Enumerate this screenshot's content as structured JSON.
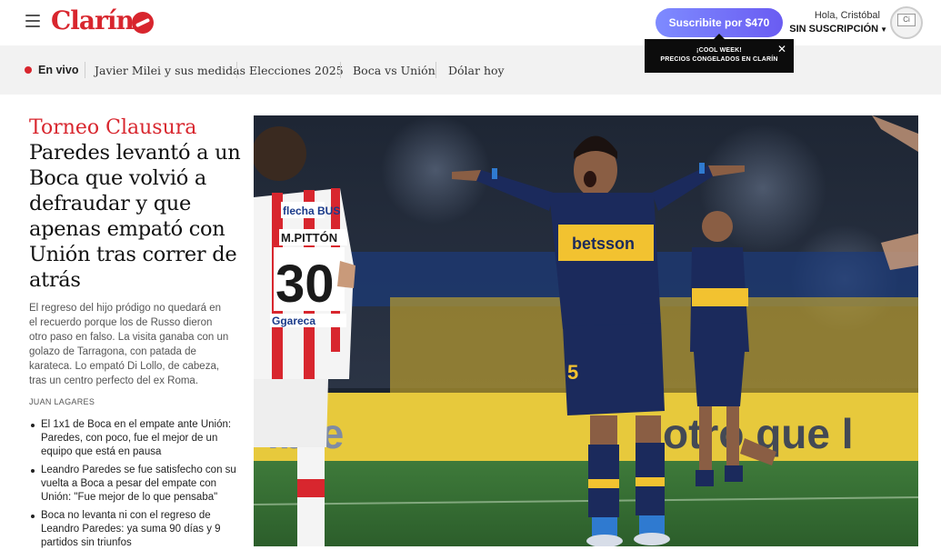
{
  "header": {
    "logo_text": "Clarín",
    "subscribe_label": "Suscribite por $470",
    "greeting": "Hola, Cristóbal",
    "subscription_status": "SIN SUSCRIPCIÓN",
    "avatar_alt": "Ci"
  },
  "promo": {
    "line1": "¡COOL WEEK!",
    "line2": "PRECIOS CONGELADOS EN CLARÍN",
    "close": "✕"
  },
  "nav": {
    "live_label": "En vivo",
    "items": [
      {
        "label": "Javier Milei y sus medidas"
      },
      {
        "label": "Elecciones 2025"
      },
      {
        "label": "Boca vs Unión"
      },
      {
        "label": "Dólar hoy"
      }
    ]
  },
  "article": {
    "section": "Torneo Clausura",
    "headline": "Paredes levantó a un Boca que volvió a defraudar y que apenas empató con Unión tras correr de atrás",
    "summary": "El regreso del hijo pródigo no quedará en el recuerdo porque los de Russo dieron otro paso en falso. La visita ganaba con un golazo de Tarragona, con patada de karateca. Lo empató Di Lollo, de cabeza, tras un centro perfecto del ex Roma.",
    "author": "JUAN LAGARES",
    "related": [
      {
        "text": "El 1x1 de Boca en el empate ante Unión: Paredes, con poco, fue el mejor de un equipo que está en pausa"
      },
      {
        "text": "Leandro Paredes se fue satisfecho con su vuelta a Boca a pesar del empate con Unión: \"Fue mejor de lo que pensaba\""
      },
      {
        "text": "Boca no levanta ni con el regreso de Leandro Paredes: ya suma 90 días y 9 partidos sin triunfos"
      }
    ]
  },
  "hero": {
    "shirt_sponsor": "betsson",
    "left_player_name": "M.PITTÓN",
    "left_player_number": "30",
    "left_sponsor_top": "flecha BUS",
    "left_sponsor_bottom": "Ggareca",
    "right_player_number": "5",
    "board_left": "ibre",
    "board_right": "otro que l"
  },
  "colors": {
    "brand_red": "#d8262e",
    "subscribe_gradient_start": "#7e8bff",
    "subscribe_gradient_end": "#6a5cf2",
    "boca_blue": "#1b2a5c",
    "boca_gold": "#f2c230"
  }
}
